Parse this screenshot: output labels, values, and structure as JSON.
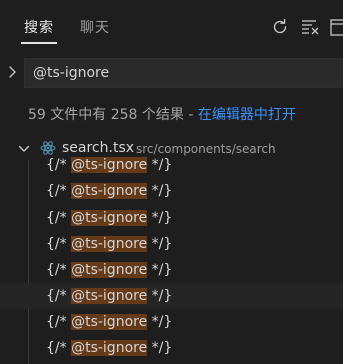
{
  "header": {
    "tabs": [
      {
        "label": "搜索",
        "active": true
      },
      {
        "label": "聊天",
        "active": false
      }
    ],
    "actions": [
      {
        "icon": "refresh-icon"
      },
      {
        "icon": "clear-results-icon"
      },
      {
        "icon": "open-new-editor-icon"
      }
    ]
  },
  "search": {
    "value": "@ts-ignore"
  },
  "summary": {
    "text": "59 文件中有 258 个结果",
    "separator": " - ",
    "link": "在编辑器中打开"
  },
  "file": {
    "name": "search.tsx",
    "path": "src/components/search",
    "icon": "react-icon"
  },
  "matches": [
    {
      "before": "{/* ",
      "hit": "@ts-ignore",
      "after": " */}"
    },
    {
      "before": "{/* ",
      "hit": "@ts-ignore",
      "after": " */}"
    },
    {
      "before": "{/* ",
      "hit": "@ts-ignore",
      "after": " */}"
    },
    {
      "before": "{/* ",
      "hit": "@ts-ignore",
      "after": " */}"
    },
    {
      "before": "{/* ",
      "hit": "@ts-ignore",
      "after": " */}"
    },
    {
      "before": "{/* ",
      "hit": "@ts-ignore",
      "after": " */}"
    },
    {
      "before": "{/* ",
      "hit": "@ts-ignore",
      "after": " */}"
    },
    {
      "before": "{/* ",
      "hit": "@ts-ignore",
      "after": " */}"
    }
  ],
  "colors": {
    "background": "#1e1e1e",
    "link": "#3794ff",
    "match_highlight": "#653a19",
    "react_icon": "#519aba"
  }
}
